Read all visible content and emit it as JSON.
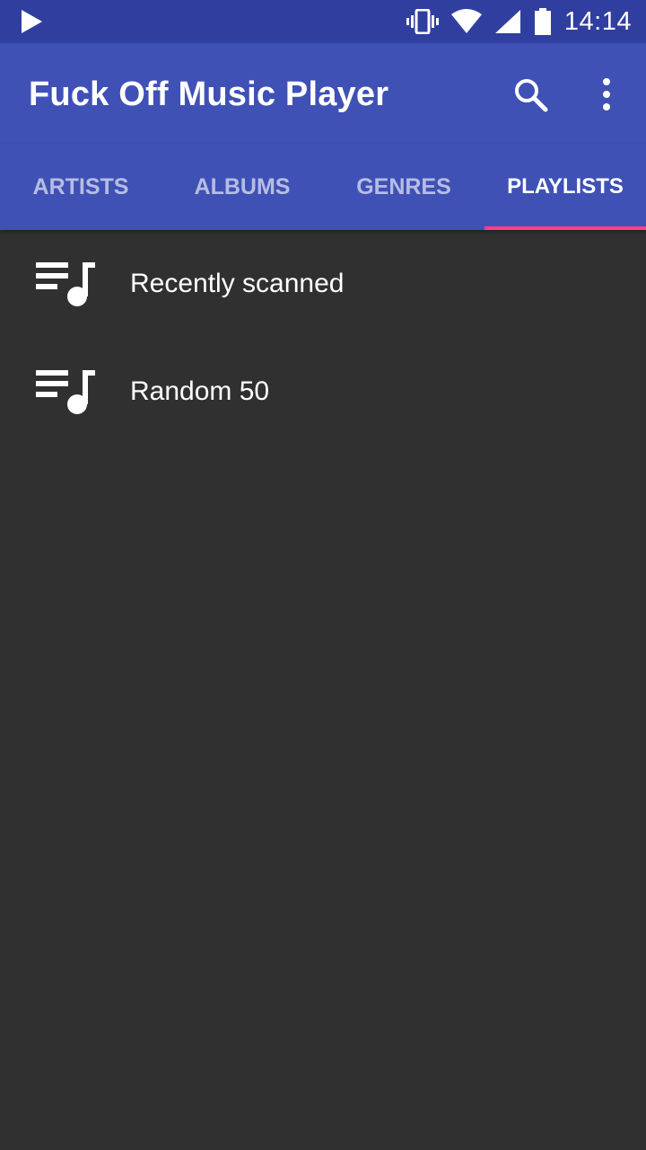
{
  "status_bar": {
    "time": "14:14",
    "icons": [
      "play-icon",
      "vibrate-icon",
      "wifi-icon",
      "signal-icon",
      "battery-icon"
    ]
  },
  "app_bar": {
    "title": "Fuck Off Music Player",
    "actions": [
      "search-icon",
      "more-vert-icon"
    ]
  },
  "tabs": [
    {
      "label": "ARTISTS",
      "active": false
    },
    {
      "label": "ALBUMS",
      "active": false
    },
    {
      "label": "GENRES",
      "active": false
    },
    {
      "label": "PLAYLISTS",
      "active": true
    }
  ],
  "playlists": [
    {
      "label": "Recently scanned",
      "icon": "playlist-music-icon"
    },
    {
      "label": "Random 50",
      "icon": "playlist-music-icon"
    }
  ],
  "colors": {
    "status_bar": "#303F9F",
    "primary": "#3F51B5",
    "accent": "#FF4081",
    "background": "#303030"
  }
}
